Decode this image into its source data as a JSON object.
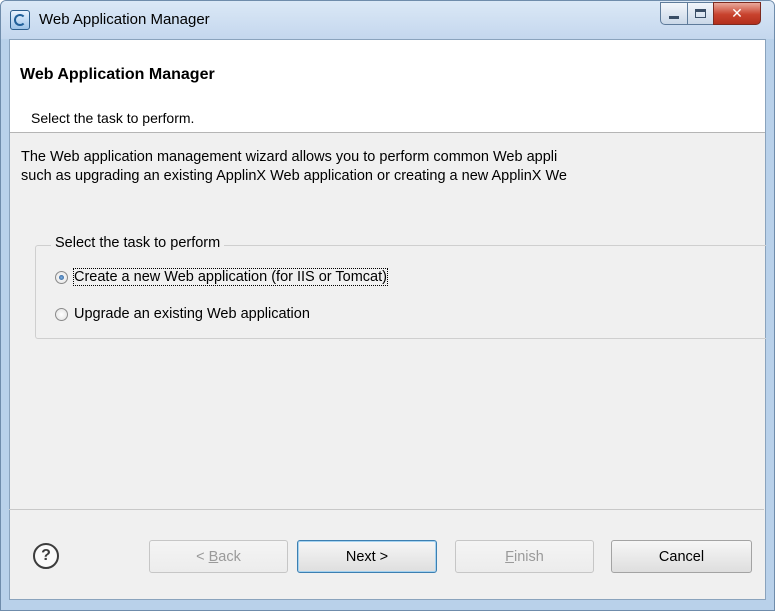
{
  "window": {
    "title": "Web Application Manager",
    "icon": "applinx-app-icon",
    "controls": {
      "minimize": "minimize-icon",
      "maximize": "maximize-icon",
      "close": "✕"
    }
  },
  "banner": {
    "title": "Web Application Manager",
    "description": "Select the task to perform."
  },
  "body": {
    "description_line_1": "The Web application management wizard allows you to perform common Web appli",
    "description_line_2": "such as upgrading an existing ApplinX Web application or creating a new ApplinX We"
  },
  "task_group": {
    "legend": "Select the task to perform",
    "options": [
      {
        "label": "Create a new Web application (for IIS or Tomcat)",
        "selected": true
      },
      {
        "label": "Upgrade an existing Web application",
        "selected": false
      }
    ]
  },
  "buttons": {
    "help": "?",
    "back": {
      "prefix": "< ",
      "mnemonic": "B",
      "rest": "ack",
      "enabled": false
    },
    "next": {
      "label": "Next >",
      "enabled": true
    },
    "finish": {
      "mnemonic": "F",
      "rest": "inish",
      "enabled": false
    },
    "cancel": {
      "label": "Cancel",
      "enabled": true
    }
  },
  "colors": {
    "accent": "#3c7fb1",
    "frame": "#b9d1ea",
    "client_bg": "#f0f0f0"
  }
}
